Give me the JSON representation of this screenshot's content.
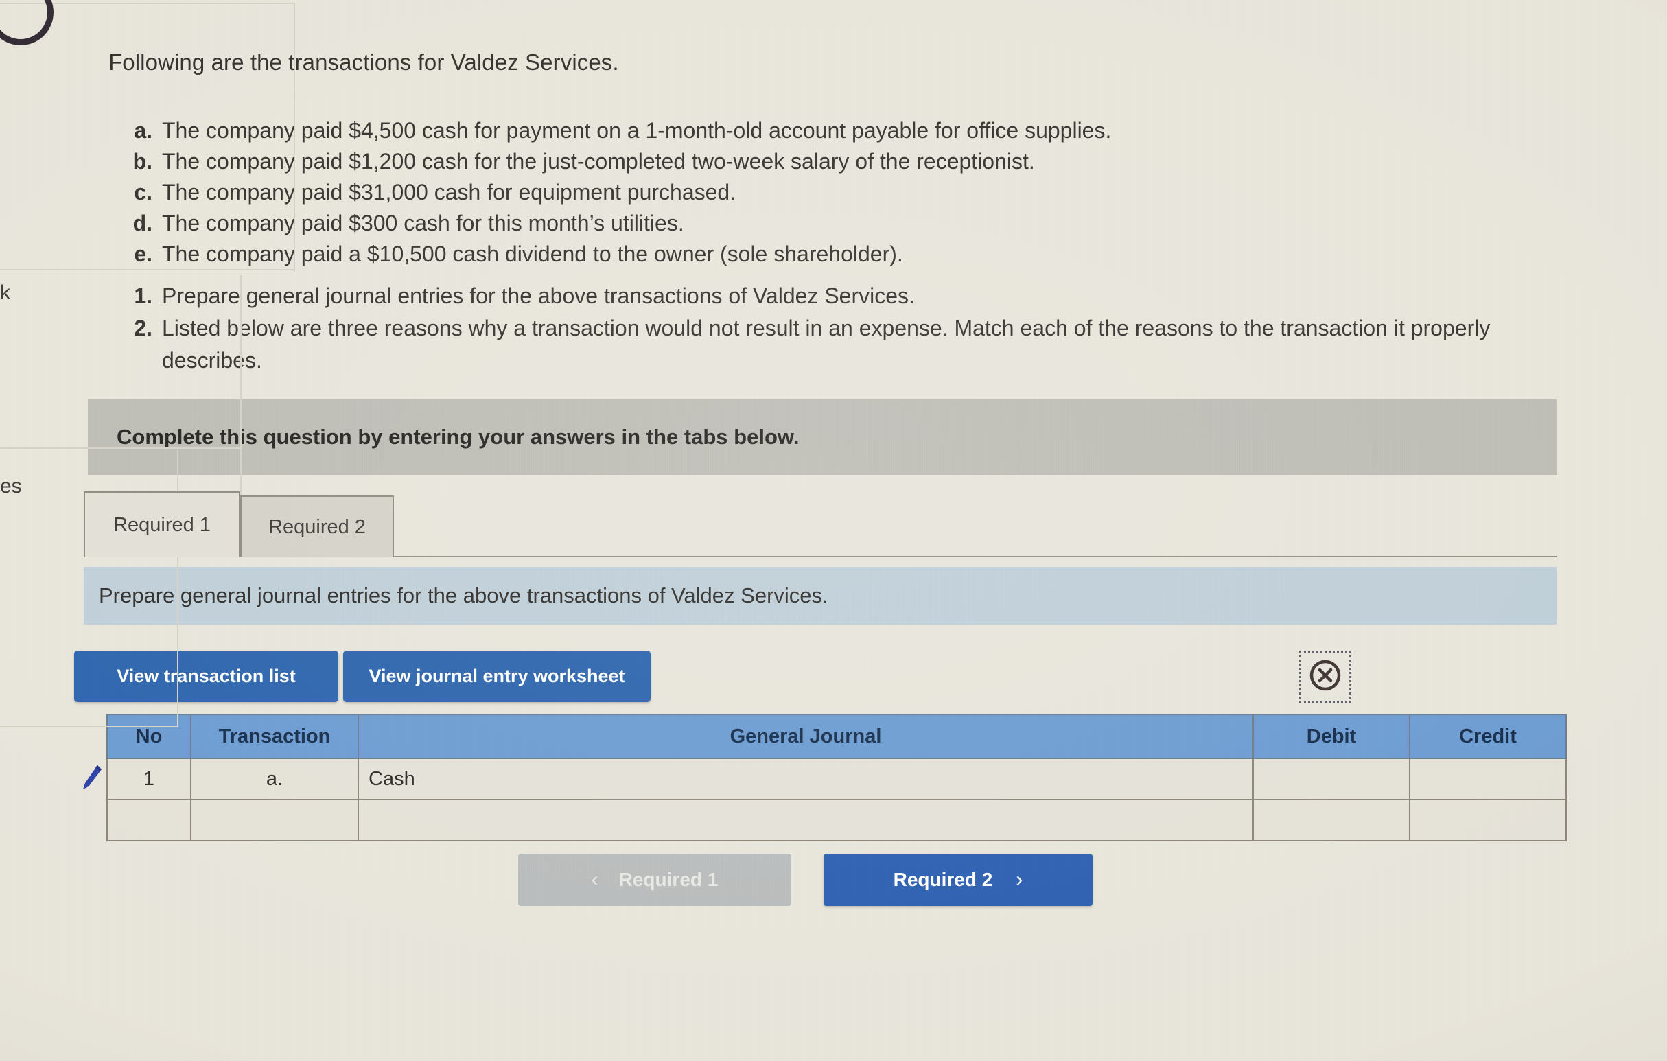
{
  "document": {
    "intro": "Following are the transactions for Valdez Services.",
    "transactions": [
      {
        "marker": "a.",
        "text": "The company paid $4,500 cash for payment on a 1-month-old account payable for office supplies."
      },
      {
        "marker": "b.",
        "text": "The company paid $1,200 cash for the just-completed two-week salary of the receptionist."
      },
      {
        "marker": "c.",
        "text": "The company paid $31,000 cash for equipment purchased."
      },
      {
        "marker": "d.",
        "text": "The company paid $300 cash for this month’s utilities."
      },
      {
        "marker": "e.",
        "text": "The company paid a $10,500 cash dividend to the owner (sole shareholder)."
      }
    ],
    "requirements": [
      {
        "marker": "1.",
        "text": "Prepare general journal entries for the above transactions of Valdez Services."
      },
      {
        "marker": "2.",
        "text": "Listed below are three reasons why a transaction would not result in an expense. Match each of the reasons to the transaction it properly describes."
      }
    ]
  },
  "complete_banner": {
    "text": "Complete this question by entering your answers in the tabs below."
  },
  "tabs": [
    {
      "label": "Required 1",
      "state": "active"
    },
    {
      "label": "Required 2",
      "state": "inactive"
    }
  ],
  "sub_instruction": {
    "text": "Prepare general journal entries for the above transactions of Valdez Services."
  },
  "toolbar": {
    "view_transaction_list_label": "View transaction list",
    "view_journal_entry_worksheet_label": "View journal entry worksheet",
    "broken_image_icon": "circled-x-icon"
  },
  "journal_table": {
    "headers": [
      "No",
      "Transaction",
      "General Journal",
      "Debit",
      "Credit"
    ],
    "rows": [
      {
        "no": "1",
        "transaction": "a.",
        "general_journal": "Cash",
        "debit": "",
        "credit": ""
      },
      {
        "no": "",
        "transaction": "",
        "general_journal": "",
        "debit": "",
        "credit": ""
      }
    ],
    "row_edit_icon": "pencil-icon"
  },
  "navigation": {
    "prev_label": "Required 1",
    "next_label": "Required 2",
    "prev_chevron": "‹",
    "next_chevron": "›"
  },
  "edge_fragments": {
    "glyph_o": "O",
    "fragment_k": "k",
    "fragment_es": "es"
  },
  "colors": {
    "page_background": "#e8e5db",
    "banner_gray": "#bdbcb4",
    "sub_instruction_blue": "#bfcfd8",
    "table_header_blue": "#6b9bd2",
    "primary_button_blue": "#2a63ac",
    "next_button_blue": "#2a5eb0",
    "disabled_button_gray": "#b9bcbc"
  }
}
